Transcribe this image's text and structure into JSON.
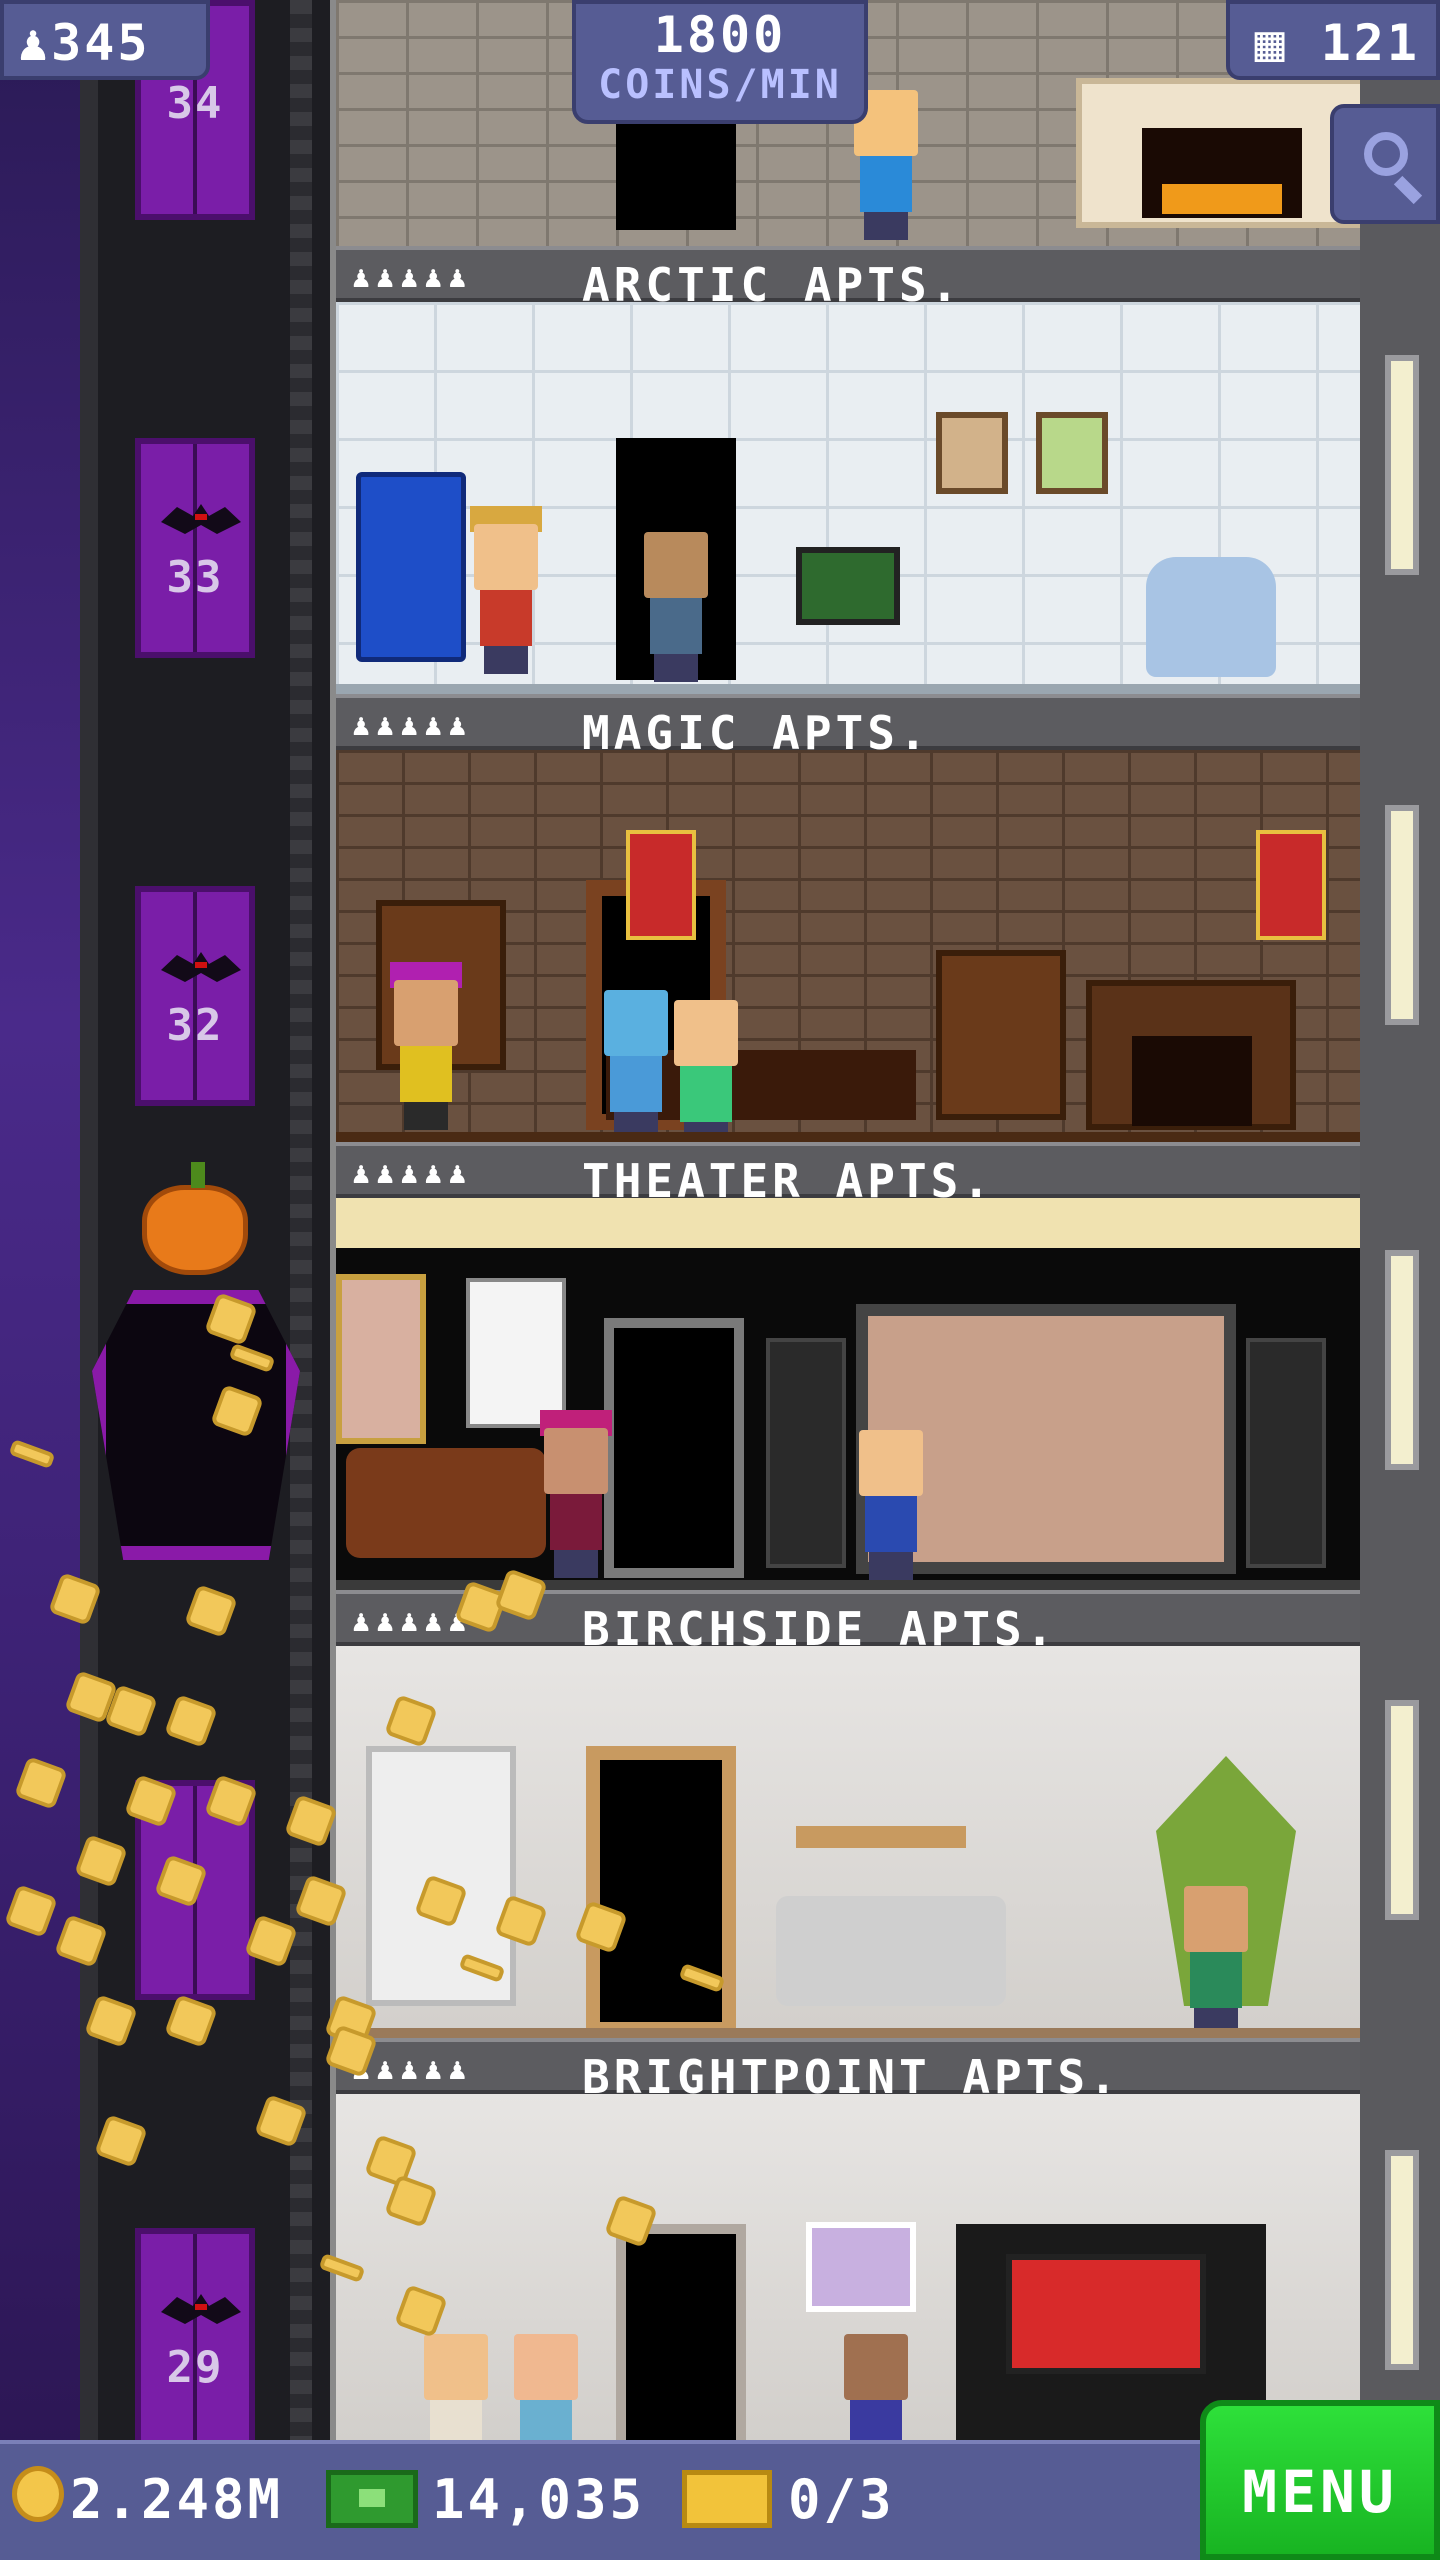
{
  "hud": {
    "population": "345",
    "floors": "121",
    "coin_rate_amount": "1800",
    "coin_rate_unit": "COINS/MIN"
  },
  "floors": [
    {
      "number": "34"
    },
    {
      "number": "33"
    },
    {
      "number": "32"
    },
    {
      "number": "29"
    }
  ],
  "rooms": [
    {
      "name": "ARCTIC APTS.",
      "occupancy_pips": "♟♟♟♟♟"
    },
    {
      "name": "MAGIC APTS.",
      "occupancy_pips": "♟♟♟♟♟"
    },
    {
      "name": "THEATER APTS.",
      "occupancy_pips": "♟♟♟♟♟"
    },
    {
      "name": "BIRCHSIDE APTS.",
      "occupancy_pips": "♟♟♟♟♟"
    },
    {
      "name": "BRIGHTPOINT APTS.",
      "occupancy_pips": "♟♟♟♟♟"
    }
  ],
  "bottom": {
    "coins": "2.248M",
    "bux": "14,035",
    "tickets": "0/3",
    "menu_label": "MENU"
  },
  "icons": {
    "population": "person-icon",
    "floors": "building-icon",
    "zoom": "magnifier-icon",
    "coins": "coin-icon",
    "bux": "bux-icon",
    "tickets": "ticket-icon"
  },
  "colors": {
    "hud": "#565c94",
    "menu": "#22c52e",
    "elevator_door": "#7a1ea8",
    "coin": "#f2c85a"
  }
}
